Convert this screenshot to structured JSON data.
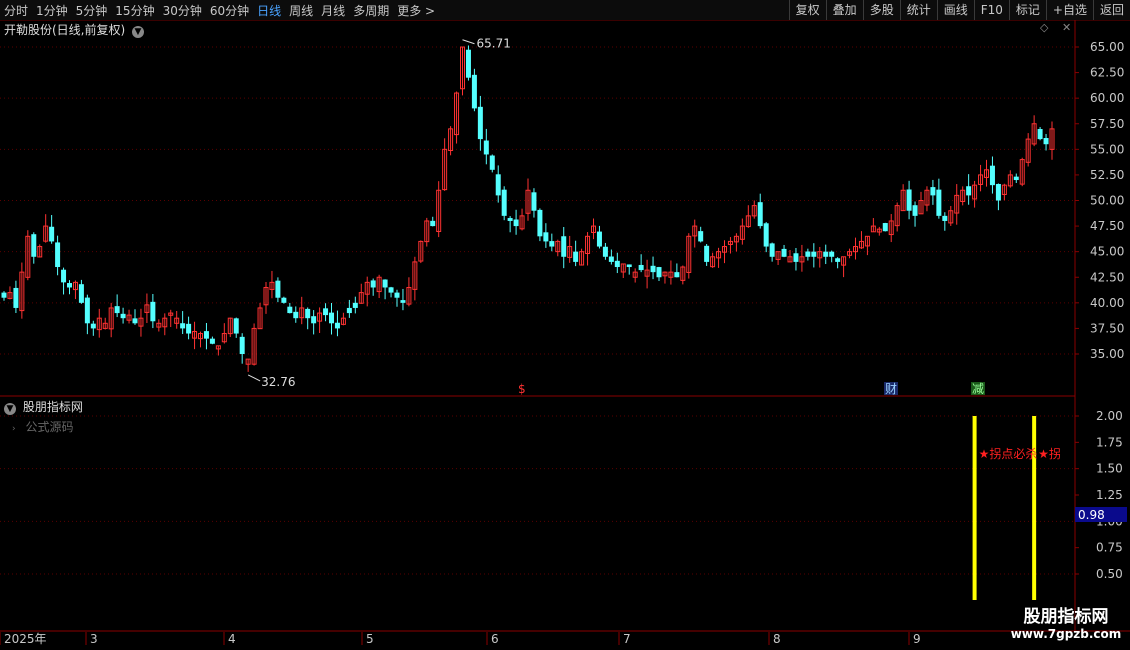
{
  "toolbar": {
    "periods": [
      "分时",
      "1分钟",
      "5分钟",
      "15分钟",
      "30分钟",
      "60分钟",
      "日线",
      "周线",
      "月线",
      "多周期",
      "更多 >"
    ],
    "active_period": "日线",
    "actions": [
      "复权",
      "叠加",
      "多股",
      "统计",
      "画线",
      "F10",
      "标记",
      "+自选",
      "返回"
    ]
  },
  "main_chart": {
    "title": "开勒股份(日线,前复权)",
    "y_axis": {
      "min": 32.5,
      "max": 66.5,
      "ticks": [
        "35.00",
        "37.50",
        "40.00",
        "42.50",
        "45.00",
        "47.50",
        "50.00",
        "52.50",
        "55.00",
        "57.50",
        "60.00",
        "62.50",
        "65.00"
      ]
    },
    "high_marker": "65.71",
    "low_marker": "32.76",
    "event_marks": [
      "$",
      "财",
      "减"
    ]
  },
  "indicator": {
    "title": "股朋指标网",
    "subtitle": "公式源码",
    "y_axis": {
      "ticks": [
        "0.50",
        "0.75",
        "1.00",
        "1.25",
        "1.50",
        "1.75",
        "2.00"
      ]
    },
    "current_value": "0.98",
    "signal_text": "★拐点必杀",
    "signal_text_2": "★拐"
  },
  "time_axis": {
    "labels": [
      "2025年",
      "3",
      "4",
      "5",
      "6",
      "7",
      "8",
      "9"
    ]
  },
  "watermark": {
    "name": "股朋指标网",
    "url": "www.7gpzb.com"
  },
  "colors": {
    "up": "#ff3232",
    "down": "#54ffff",
    "grid": "#5a0000",
    "signal": "#ffff00"
  },
  "chart_data": {
    "type": "candlestick",
    "approx_closes": [
      40.5,
      41.0,
      39.5,
      43.0,
      46.5,
      44.5,
      45.5,
      47.5,
      46.0,
      43.5,
      42.0,
      41.5,
      42.0,
      40.0,
      38.0,
      37.5,
      38.5,
      38.0,
      39.5,
      39.0,
      38.5,
      38.8,
      38.0,
      38.5,
      39.8,
      38.2,
      38.0,
      38.5,
      39.0,
      38.5,
      37.5,
      37.0,
      37.2,
      37.0,
      36.5,
      36.0,
      35.8,
      37.0,
      38.5,
      37.0,
      35.0,
      34.5,
      37.5,
      39.5,
      41.5,
      42.0,
      40.5,
      40.0,
      39.0,
      38.5,
      39.5,
      38.5,
      38.0,
      39.0,
      38.8,
      38.0,
      37.5,
      38.5,
      39.0,
      39.5,
      41.0,
      42.0,
      41.5,
      42.5,
      41.5,
      41.0,
      40.5,
      40.0,
      41.5,
      44.0,
      46.0,
      48.0,
      47.5,
      51.0,
      55.0,
      57.0,
      60.5,
      65.0,
      62.0,
      59.0,
      56.0,
      54.5,
      53.0,
      50.5,
      48.5,
      48.0,
      47.5,
      48.5,
      51.0,
      49.0,
      46.5,
      46.0,
      45.5,
      46.0,
      44.5,
      45.5,
      44.0,
      45.0,
      46.5,
      47.5,
      45.5,
      44.5,
      44.0,
      43.5,
      43.8,
      43.5,
      43.0,
      43.2,
      43.2,
      43.0,
      42.5,
      43.0,
      43.0,
      42.5,
      43.5,
      46.5,
      47.5,
      46.0,
      44.0,
      44.5,
      45.0,
      45.5,
      46.0,
      46.5,
      47.5,
      48.5,
      49.5,
      47.5,
      45.5,
      44.5,
      45.0,
      44.5,
      44.5,
      44.0,
      44.5,
      44.5,
      44.5,
      45.0,
      44.5,
      44.5,
      44.0,
      44.5,
      45.0,
      45.5,
      46.0,
      46.5,
      47.5,
      47.2,
      47.0,
      48.0,
      49.5,
      51.0,
      49.0,
      48.5,
      50.0,
      51.0,
      50.5,
      48.5,
      48.0,
      49.0,
      50.5,
      51.0,
      50.5,
      51.5,
      52.5,
      53.0,
      51.5,
      50.0,
      51.5,
      52.5,
      52.0,
      54.0,
      56.0,
      57.5,
      56.0,
      55.5,
      57.0
    ],
    "signal_bars_index": [
      163,
      173
    ]
  }
}
